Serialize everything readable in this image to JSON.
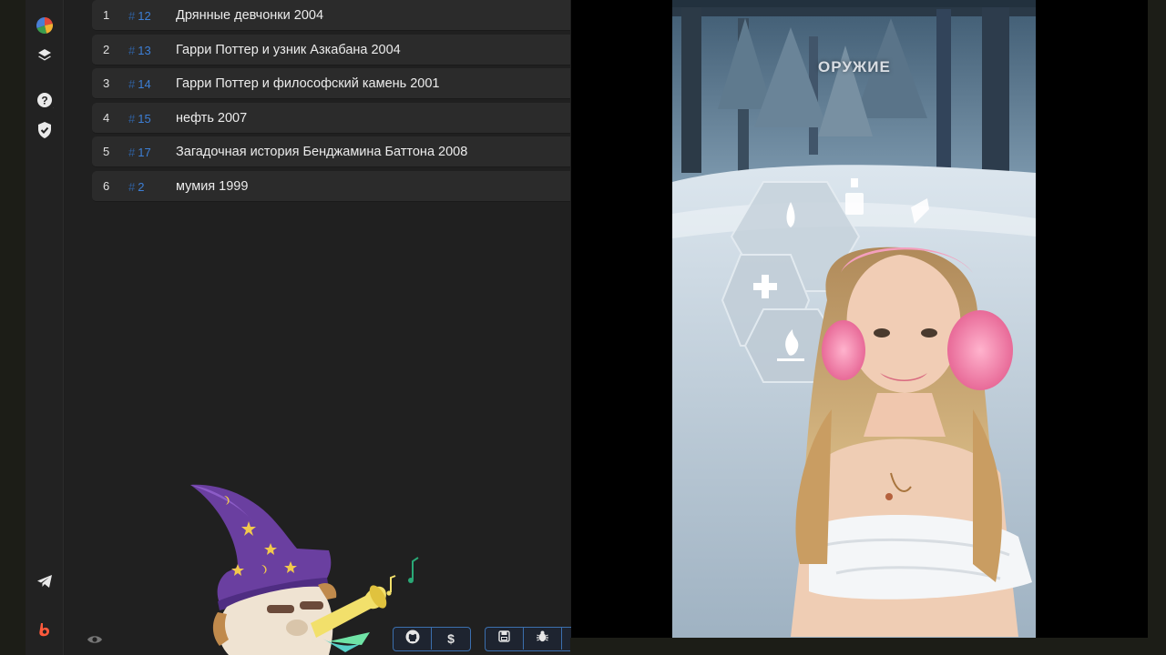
{
  "list": {
    "rows": [
      {
        "num": "1",
        "tag_hash": "#",
        "tag": "12",
        "title": "Дрянные девчонки 2004"
      },
      {
        "num": "2",
        "tag_hash": "#",
        "tag": "13",
        "title": "Гарри Поттер и узник Азкабана 2004"
      },
      {
        "num": "3",
        "tag_hash": "#",
        "tag": "14",
        "title": "Гарри Поттер и философский камень 2001"
      },
      {
        "num": "4",
        "tag_hash": "#",
        "tag": "15",
        "title": "нефть 2007"
      },
      {
        "num": "5",
        "tag_hash": "#",
        "tag": "17",
        "title": "Загадочная история Бенджамина Баттона 2008"
      },
      {
        "num": "6",
        "tag_hash": "#",
        "tag": "2",
        "title": "мумия 1999"
      }
    ]
  },
  "sidebar": {
    "icons": [
      "pie-chart-icon",
      "layers-icon",
      "help-icon",
      "shield-check-icon",
      "telegram-icon",
      "brand-b-icon"
    ]
  },
  "toolbar": {
    "dollar_label": "$",
    "icons": [
      "github-icon",
      "dollar-icon",
      "save-icon",
      "bug-icon"
    ]
  },
  "video": {
    "overlay_text": "ОРУЖИЕ"
  },
  "colors": {
    "accent": "#3b6fae",
    "tag": "#3d7fd6",
    "row_bg": "#2b2b2b",
    "panel_bg": "#202020"
  }
}
